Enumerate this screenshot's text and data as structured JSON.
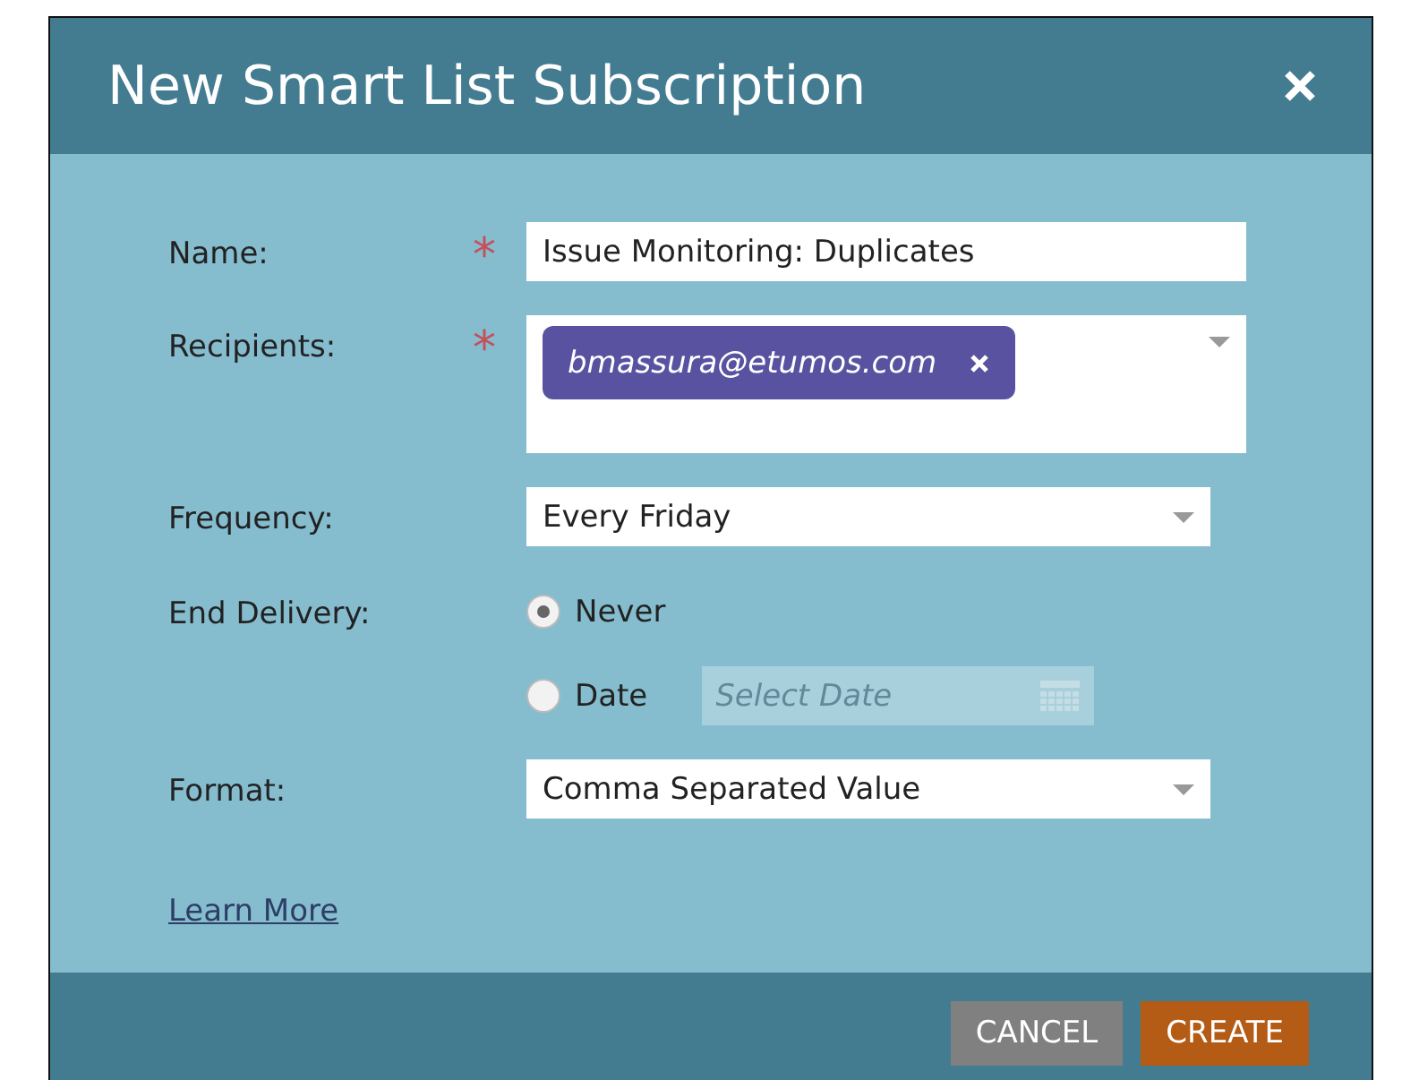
{
  "window": {
    "title": "New Smart List Subscription"
  },
  "form": {
    "name": {
      "label": "Name:",
      "required_mark": "*",
      "value": "Issue Monitoring: Duplicates"
    },
    "recipients": {
      "label": "Recipients:",
      "required_mark": "*",
      "tokens": [
        "bmassura@etumos.com"
      ]
    },
    "frequency": {
      "label": "Frequency:",
      "value": "Every Friday"
    },
    "end_delivery": {
      "label": "End Delivery:",
      "options": [
        {
          "label": "Never",
          "selected": true
        },
        {
          "label": "Date",
          "selected": false
        }
      ],
      "date": {
        "placeholder": "Select Date",
        "disabled": true
      }
    },
    "format": {
      "label": "Format:",
      "value": "Comma Separated Value"
    }
  },
  "learn_more": "Learn More",
  "buttons": [
    {
      "label": "CANCEL",
      "kind": "secondary"
    },
    {
      "label": "CREATE",
      "kind": "primary"
    }
  ]
}
